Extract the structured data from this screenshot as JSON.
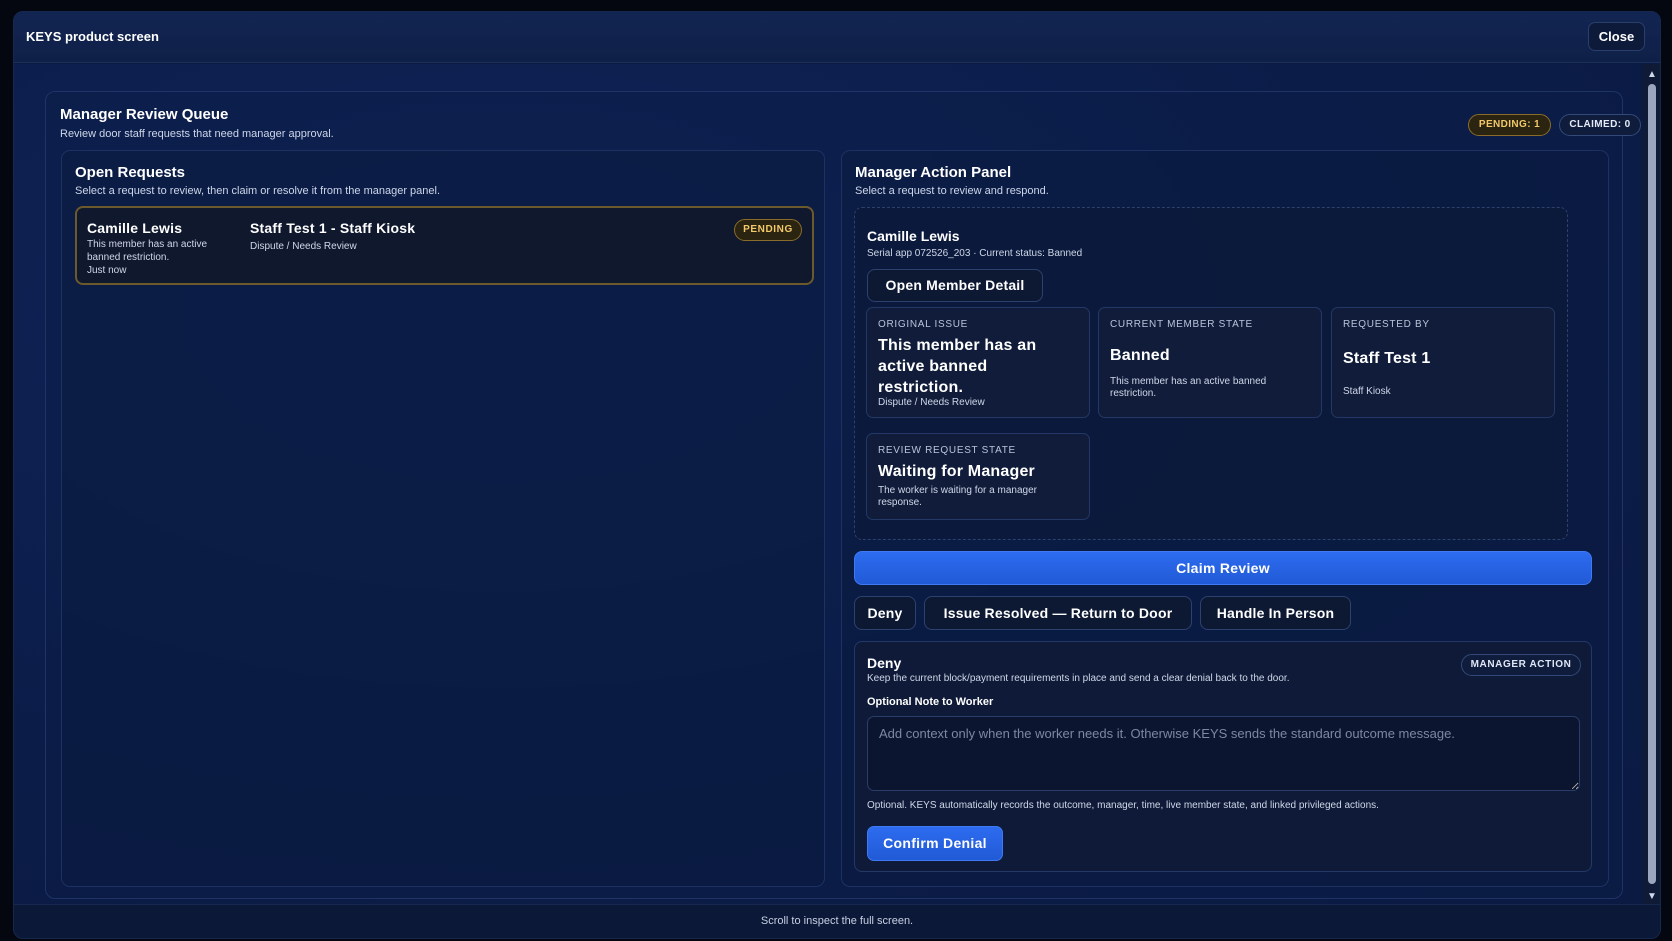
{
  "window": {
    "title": "KEYS product screen",
    "close_label": "Close"
  },
  "footer": {
    "hint": "Scroll to inspect the full screen."
  },
  "queue": {
    "title": "Manager Review Queue",
    "subtitle": "Review door staff requests that need manager approval.",
    "pending_badge": "PENDING: 1",
    "claimed_badge": "CLAIMED: 0"
  },
  "open_requests": {
    "title": "Open Requests",
    "subtitle": "Select a request to review, then claim or resolve it from the manager panel.",
    "items": [
      {
        "member_name": "Camille Lewis",
        "issue": "This member has an active banned restriction.",
        "time": "Just now",
        "staff": "Staff Test 1 - Staff Kiosk",
        "type": "Dispute / Needs Review",
        "status": "PENDING"
      }
    ]
  },
  "action_panel": {
    "title": "Manager Action Panel",
    "subtitle": "Select a request to review and respond.",
    "member": {
      "name": "Camille Lewis",
      "meta": "Serial app 072526_203 · Current status: Banned",
      "detail_button": "Open Member Detail"
    },
    "cards": {
      "original_issue": {
        "label": "ORIGINAL ISSUE",
        "value": "This member has an active banned restriction.",
        "note": "Dispute / Needs Review"
      },
      "member_state": {
        "label": "CURRENT MEMBER STATE",
        "value": "Banned",
        "note": "This member has an active banned restriction."
      },
      "requested_by": {
        "label": "REQUESTED BY",
        "value": "Staff Test 1",
        "note": "Staff Kiosk"
      },
      "review_state": {
        "label": "REVIEW REQUEST STATE",
        "value": "Waiting for Manager",
        "note": "The worker is waiting for a manager response."
      }
    },
    "claim_button": "Claim Review",
    "options": {
      "deny": "Deny",
      "resolved": "Issue Resolved — Return to Door",
      "in_person": "Handle In Person"
    },
    "deny_section": {
      "title": "Deny",
      "subtitle": "Keep the current block/payment requirements in place and send a clear denial back to the door.",
      "badge": "MANAGER ACTION",
      "note_label": "Optional Note to Worker",
      "note_value": "",
      "note_placeholder": "Add context only when the worker needs it. Otherwise KEYS sends the standard outcome message.",
      "help": "Optional. KEYS automatically records the outcome, manager, time, live member state, and linked privileged actions.",
      "confirm_button": "Confirm Denial"
    }
  }
}
